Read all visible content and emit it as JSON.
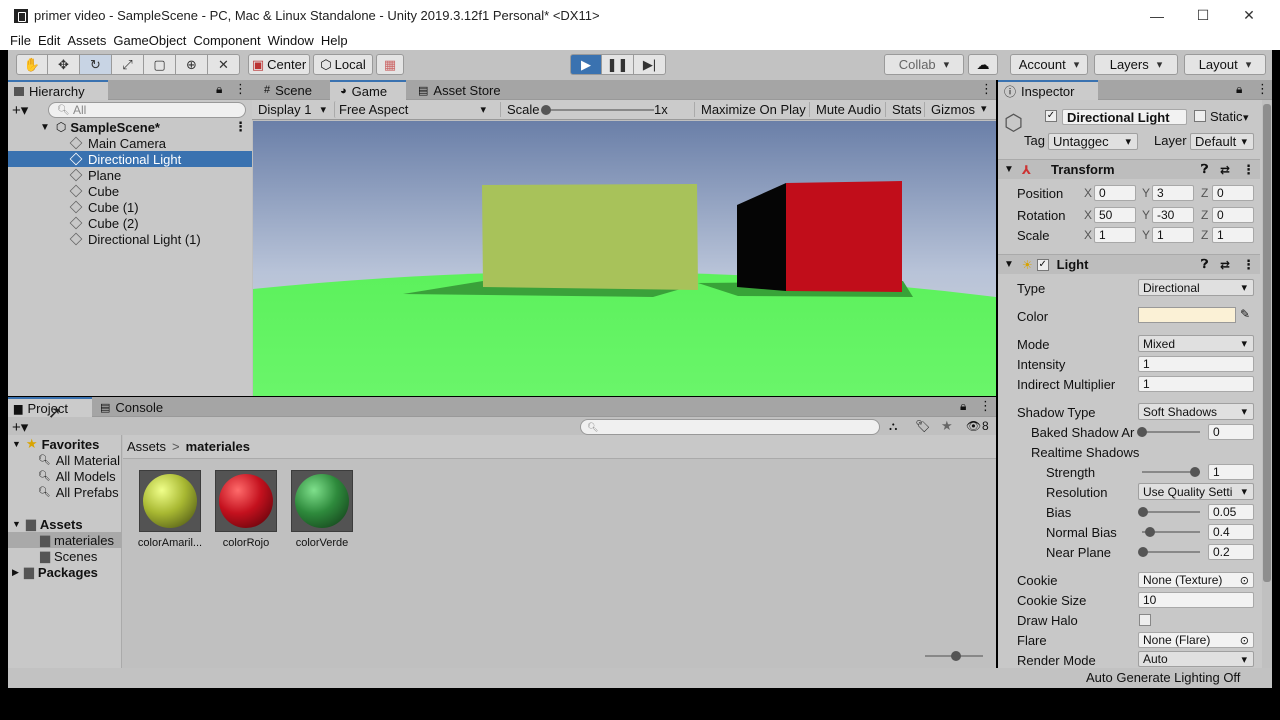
{
  "window": {
    "title": "primer video - SampleScene - PC, Mac & Linux Standalone - Unity 2019.3.12f1 Personal* <DX11>",
    "minimize": "—",
    "maximize": "☐",
    "close": "✕"
  },
  "menu": [
    "File",
    "Edit",
    "Assets",
    "GameObject",
    "Component",
    "Window",
    "Help"
  ],
  "toolbar": {
    "center": "Center",
    "local": "Local",
    "collab": "Collab",
    "account": "Account",
    "layers": "Layers",
    "layout": "Layout"
  },
  "hierarchy": {
    "tab": "Hierarchy",
    "search_placeholder": "All",
    "scene": "SampleScene*",
    "items": [
      "Main Camera",
      "Directional Light",
      "Plane",
      "Cube",
      "Cube (1)",
      "Cube (2)",
      "Directional Light (1)"
    ]
  },
  "scene_tabs": {
    "scene": "Scene",
    "game": "Game",
    "store": "Asset Store",
    "display": "Display 1",
    "aspect": "Free Aspect",
    "scale_label": "Scale",
    "scale_value": "1x",
    "maximize": "Maximize On Play",
    "mute": "Mute Audio",
    "stats": "Stats",
    "gizmos": "Gizmos"
  },
  "project": {
    "tab": "Project",
    "console_tab": "Console",
    "hidden_count": "8",
    "favorites": "Favorites",
    "fav_items": [
      "All Material",
      "All Models",
      "All Prefabs"
    ],
    "assets": "Assets",
    "folders": [
      "materiales",
      "Scenes"
    ],
    "packages": "Packages",
    "breadcrumb_root": "Assets",
    "breadcrumb_sep": ">",
    "breadcrumb_current": "materiales",
    "items": [
      {
        "name": "colorAmaril...",
        "color": "#a8b832"
      },
      {
        "name": "colorRojo",
        "color": "#c4111e"
      },
      {
        "name": "colorVerde",
        "color": "#2e8a3c"
      }
    ]
  },
  "inspector": {
    "tab": "Inspector",
    "object_name": "Directional Light",
    "static": "Static",
    "tag_label": "Tag",
    "tag_value": "Untaggec",
    "layer_label": "Layer",
    "layer_value": "Default",
    "transform": "Transform",
    "position": "Position",
    "rotation": "Rotation",
    "scale": "Scale",
    "pos": [
      "0",
      "3",
      "0"
    ],
    "rot": [
      "50",
      "-30",
      "0"
    ],
    "scl": [
      "1",
      "1",
      "1"
    ],
    "light": "Light",
    "type_label": "Type",
    "type_value": "Directional",
    "color_label": "Color",
    "color_value": "#fbf1d6",
    "mode_label": "Mode",
    "mode_value": "Mixed",
    "intensity_label": "Intensity",
    "intensity_value": "1",
    "indirect_label": "Indirect Multiplier",
    "indirect_value": "1",
    "shadow_type_label": "Shadow Type",
    "shadow_type_value": "Soft Shadows",
    "baked_label": "Baked Shadow Ar",
    "baked_value": "0",
    "realtime_label": "Realtime Shadows",
    "strength_label": "Strength",
    "strength_value": "1",
    "resolution_label": "Resolution",
    "resolution_value": "Use Quality Setti",
    "bias_label": "Bias",
    "bias_value": "0.05",
    "normal_bias_label": "Normal Bias",
    "normal_bias_value": "0.4",
    "near_plane_label": "Near Plane",
    "near_plane_value": "0.2",
    "cookie_label": "Cookie",
    "cookie_value": "None (Texture)",
    "cookie_size_label": "Cookie Size",
    "cookie_size_value": "10",
    "draw_halo_label": "Draw Halo",
    "flare_label": "Flare",
    "flare_value": "None (Flare)",
    "render_mode_label": "Render Mode",
    "render_mode_value": "Auto"
  },
  "status": {
    "lighting": "Auto Generate Lighting Off"
  }
}
